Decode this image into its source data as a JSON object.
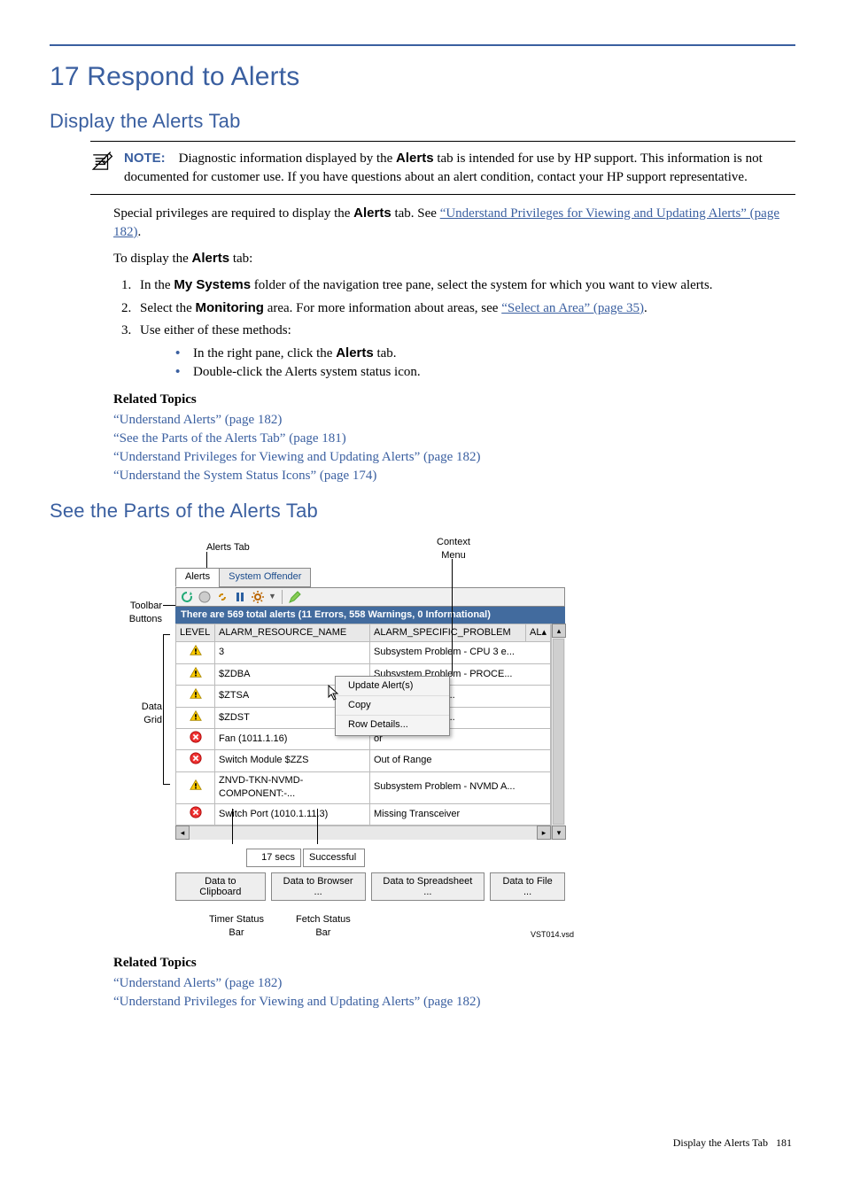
{
  "chapter_title": "17 Respond to Alerts",
  "section1_title": "Display the Alerts Tab",
  "note": {
    "label": "NOTE:",
    "text_pre": "Diagnostic information displayed by the ",
    "text_bold1": "Alerts",
    "text_mid": " tab is intended for use by HP support. This information is not documented for customer use. If you have questions about an alert condition, contact your HP support representative."
  },
  "para1_pre": "Special privileges are required to display the ",
  "para1_bold": "Alerts",
  "para1_mid": " tab. See ",
  "para1_link": "“Understand Privileges for Viewing and Updating Alerts” (page 182)",
  "para1_post": ".",
  "para2_pre": "To display the ",
  "para2_bold": "Alerts",
  "para2_post": " tab:",
  "step1_pre": "In the ",
  "step1_bold": "My Systems",
  "step1_post": " folder of the navigation tree pane, select the system for which you want to view alerts.",
  "step2_pre": "Select the ",
  "step2_bold": "Monitoring",
  "step2_mid": " area. For more information about areas, see ",
  "step2_link": "“Select an Area” (page 35)",
  "step2_post": ".",
  "step3": "Use either of these methods:",
  "sub1_pre": "In the right pane, click the ",
  "sub1_bold": "Alerts",
  "sub1_post": " tab.",
  "sub2": "Double-click the Alerts system status icon.",
  "related_heading": "Related Topics",
  "rel1": "“Understand Alerts” (page 182)",
  "rel2": "“See the Parts of the Alerts Tab” (page 181)",
  "rel3": "“Understand Privileges for Viewing and Updating Alerts” (page 182)",
  "rel4": "“Understand the System Status Icons” (page 174)",
  "section2_title": "See the Parts of the Alerts Tab",
  "figure": {
    "callouts": {
      "alerts_tab": "Alerts Tab",
      "context_menu": "Context\nMenu",
      "toolbar_buttons": "Toolbar\nButtons",
      "data_grid": "Data\nGrid",
      "timer_status": "Timer Status\nBar",
      "fetch_status": "Fetch Status\nBar",
      "vsd": "VST014.vsd"
    },
    "tabs": {
      "alerts": "Alerts",
      "offender": "System Offender"
    },
    "statusbar": "There are 569 total alerts (11 Errors, 558 Warnings, 0 Informational)",
    "headers": {
      "level": "LEVEL",
      "resource": "ALARM_RESOURCE_NAME",
      "problem": "ALARM_SPECIFIC_PROBLEM",
      "al": "AL"
    },
    "rows": [
      {
        "icon": "warn",
        "resource": "3",
        "problem": "Subsystem Problem - CPU 3 e..."
      },
      {
        "icon": "warn",
        "resource": "$ZDBA",
        "problem": "Subsystem Problem - PROCE..."
      },
      {
        "icon": "warn",
        "resource": "$ZTSA",
        "problem": "roblem - PROCE..."
      },
      {
        "icon": "warn",
        "resource": "$ZDST",
        "problem": "roblem - PROCE..."
      },
      {
        "icon": "err",
        "resource": "Fan (1011.1.16)",
        "problem": "or"
      },
      {
        "icon": "err",
        "resource": "Switch Module $ZZS",
        "problem": "Out of Range"
      },
      {
        "icon": "warn",
        "resource": "ZNVD-TKN-NVMD-COMPONENT:-...",
        "problem": "Subsystem Problem - NVMD A..."
      },
      {
        "icon": "err",
        "resource": "Switch Port (1010.1.11.3)",
        "problem": "Missing Transceiver"
      }
    ],
    "context_menu": [
      "Update Alert(s)",
      "Copy",
      "Row Details..."
    ],
    "timer": {
      "secs": "17 secs",
      "status": "Successful"
    },
    "buttons": [
      "Data to Clipboard",
      "Data to Browser ...",
      "Data to Spreadsheet ...",
      "Data to File ..."
    ]
  },
  "rel_b1": "“Understand Alerts” (page 182)",
  "rel_b2": "“Understand Privileges for Viewing and Updating Alerts” (page 182)",
  "footer": {
    "text": "Display the Alerts Tab",
    "page": "181"
  }
}
